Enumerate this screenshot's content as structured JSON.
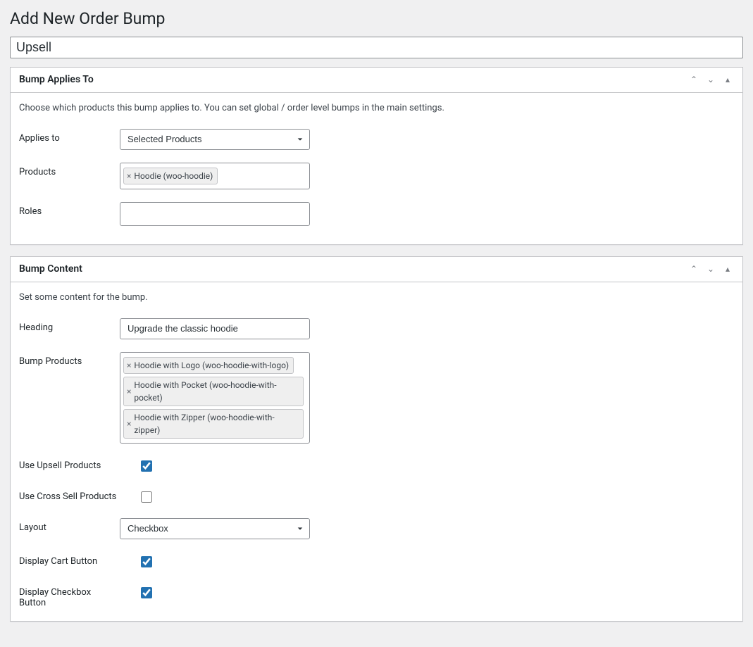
{
  "page_title": "Add New Order Bump",
  "title_value": "Upsell",
  "panels": {
    "applies": {
      "title": "Bump Applies To",
      "description": "Choose which products this bump applies to. You can set global / order level bumps in the main settings.",
      "rows": {
        "applies_to_label": "Applies to",
        "applies_to_value": "Selected Products",
        "products_label": "Products",
        "products_tags": [
          "Hoodie (woo-hoodie)"
        ],
        "roles_label": "Roles"
      }
    },
    "content": {
      "title": "Bump Content",
      "description": "Set some content for the bump.",
      "rows": {
        "heading_label": "Heading",
        "heading_value": "Upgrade the classic hoodie",
        "bump_products_label": "Bump Products",
        "bump_products_tags": [
          "Hoodie with Logo (woo-hoodie-with-logo)",
          "Hoodie with Pocket (woo-hoodie-with-pocket)",
          "Hoodie with Zipper (woo-hoodie-with-zipper)"
        ],
        "use_upsell_label": "Use Upsell Products",
        "use_upsell_checked": true,
        "use_cross_sell_label": "Use Cross Sell Products",
        "use_cross_sell_checked": false,
        "layout_label": "Layout",
        "layout_value": "Checkbox",
        "display_cart_label": "Display Cart Button",
        "display_cart_checked": true,
        "display_checkbox_label": "Display Checkbox Button",
        "display_checkbox_checked": true
      }
    }
  },
  "icons": {
    "remove": "×",
    "up": "⌃",
    "down": "⌄",
    "collapse": "▴"
  }
}
